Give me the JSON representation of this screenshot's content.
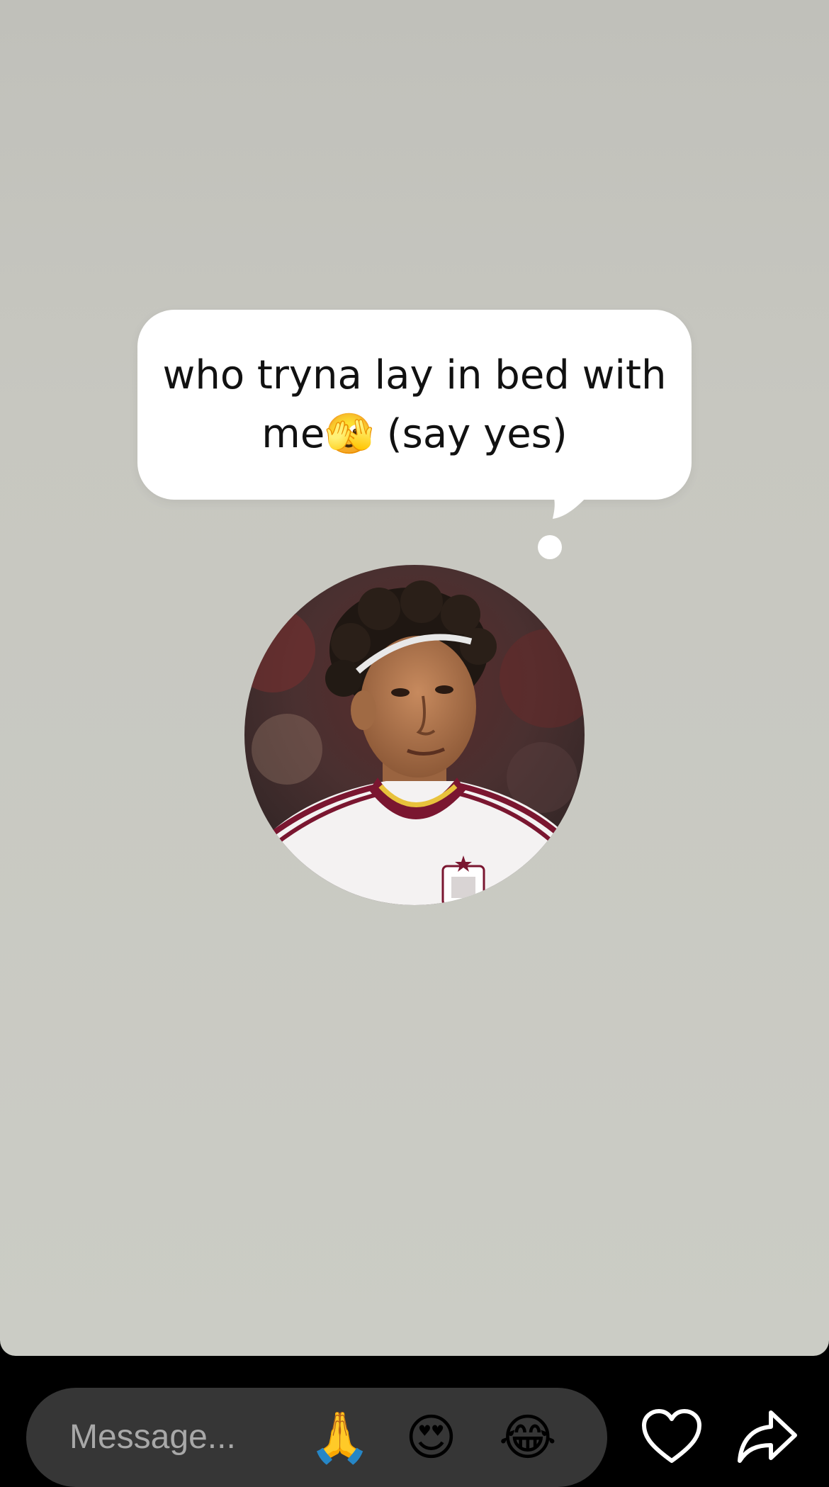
{
  "story": {
    "background_color": "#c8c8c2",
    "thought_bubble": {
      "text_line1": "who tryna lay in bed with",
      "text_line2": "me🫣 (say yes)"
    },
    "avatar": {
      "jersey_color": "#ffffff",
      "collar_color": "#7a1630",
      "collar_trim_color": "#e8c23c"
    }
  },
  "reply_bar": {
    "message_placeholder": "Message...",
    "quick_reactions": [
      {
        "emoji": "🙏",
        "icon": "folded-hands-emoji"
      },
      {
        "emoji": "😍",
        "icon": "heart-eyes-emoji"
      },
      {
        "emoji": "😂",
        "icon": "tears-of-joy-emoji"
      }
    ],
    "like_icon": "heart-outline-icon",
    "share_icon": "share-arrow-icon"
  }
}
